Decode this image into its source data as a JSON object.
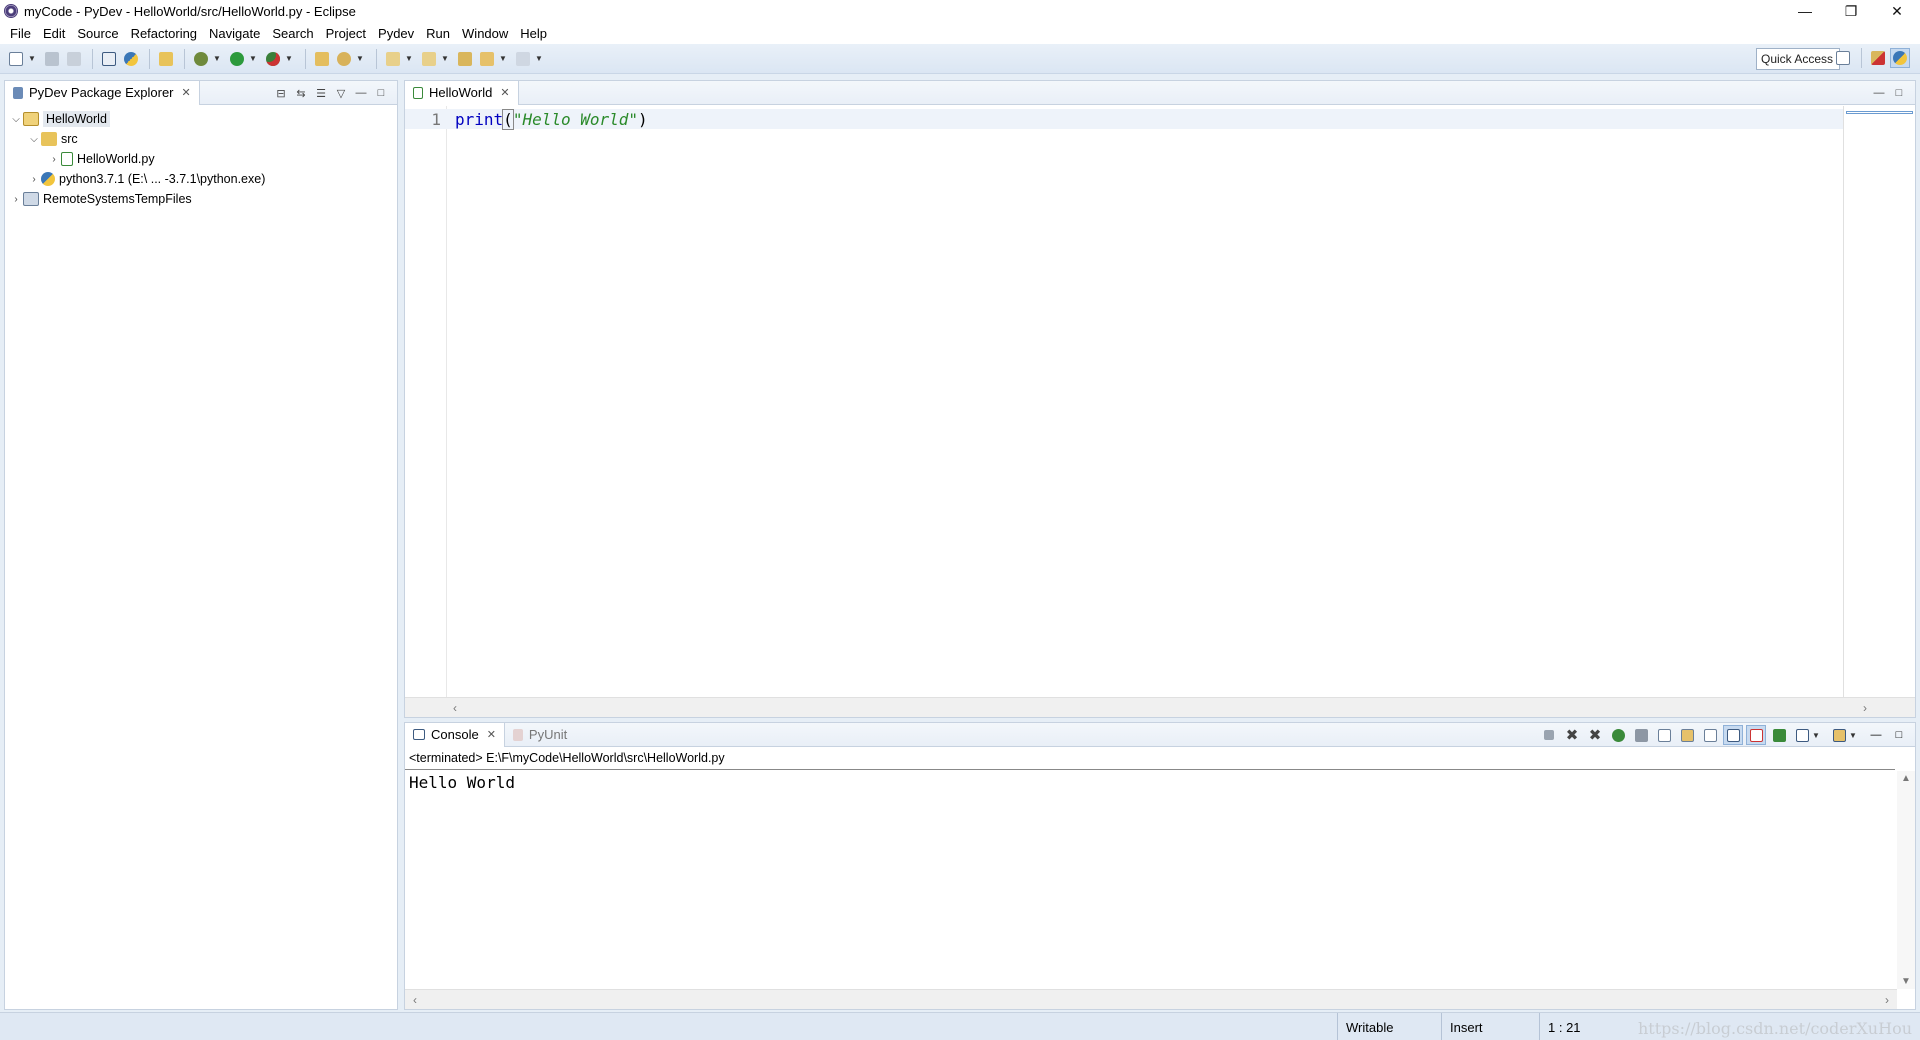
{
  "window": {
    "title": "myCode - PyDev - HelloWorld/src/HelloWorld.py - Eclipse",
    "controls": {
      "minimize": "—",
      "restore": "❐",
      "close": "✕"
    }
  },
  "menu": [
    "File",
    "Edit",
    "Source",
    "Refactoring",
    "Navigate",
    "Search",
    "Project",
    "Pydev",
    "Run",
    "Window",
    "Help"
  ],
  "toolbar": {
    "quick_access": "Quick Access"
  },
  "package_explorer": {
    "tab_label": "PyDev Package Explorer",
    "tree": {
      "project": "HelloWorld",
      "src": "src",
      "file": "HelloWorld.py",
      "interpreter": "python3.7.1  (E:\\ ... -3.7.1\\python.exe)",
      "remote": "RemoteSystemsTempFiles"
    }
  },
  "editor": {
    "tab_label": "HelloWorld",
    "line_number": "1",
    "code": {
      "keyword": "print",
      "open_paren": "(",
      "string": "\"Hello World\"",
      "close_paren": ")"
    }
  },
  "console": {
    "tab_label": "Console",
    "tab2_label": "PyUnit",
    "terminated": "<terminated> E:\\F\\myCode\\HelloWorld\\src\\HelloWorld.py",
    "output": "Hello World"
  },
  "status": {
    "writable": "Writable",
    "insert": "Insert",
    "position": "1 : 21",
    "watermark": "https://blog.csdn.net/coderXuHou"
  },
  "colors": {
    "keyword": "#0000c0",
    "string": "#2a8a2a",
    "accent": "#c7daf0"
  }
}
